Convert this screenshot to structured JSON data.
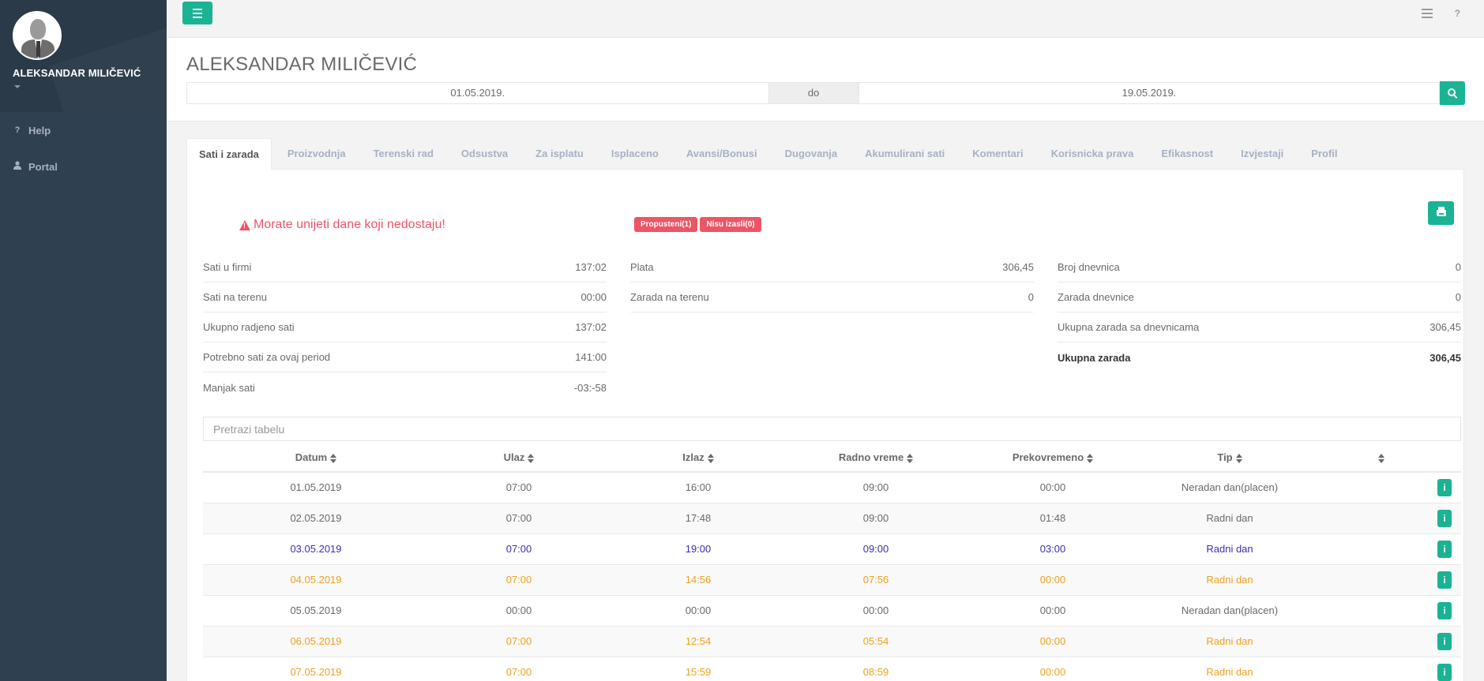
{
  "sidebar": {
    "user_name": "ALEKSANDAR MILIČEVIĆ",
    "items": [
      {
        "label": "Help",
        "icon": "?"
      },
      {
        "label": "Portal",
        "icon": "user-icon"
      }
    ]
  },
  "topbar": {
    "help_label": "?"
  },
  "header": {
    "title": "ALEKSANDAR MILIČEVIĆ",
    "date_from": "01.05.2019.",
    "separator": "do",
    "date_to": "19.05.2019."
  },
  "tabs": [
    {
      "label": "Sati i zarada"
    },
    {
      "label": "Proizvodnja"
    },
    {
      "label": "Terenski rad"
    },
    {
      "label": "Odsustva"
    },
    {
      "label": "Za isplatu"
    },
    {
      "label": "Isplaceno"
    },
    {
      "label": "Avansi/Bonusi"
    },
    {
      "label": "Dugovanja"
    },
    {
      "label": "Akumulirani sati"
    },
    {
      "label": "Komentari"
    },
    {
      "label": "Korisnicka prava"
    },
    {
      "label": "Efikasnost"
    },
    {
      "label": "Izvjestaji"
    },
    {
      "label": "Profil"
    }
  ],
  "alert": {
    "message": "Morate unijeti dane koji nedostaju!",
    "badges": [
      "Propusteni(1)",
      "Nisu izasli(0)"
    ]
  },
  "stats": {
    "col1": [
      {
        "label": "Sati u firmi",
        "value": "137:02"
      },
      {
        "label": "Sati na terenu",
        "value": "00:00"
      },
      {
        "label": "Ukupno radjeno sati",
        "value": "137:02"
      },
      {
        "label": "Potrebno sati za ovaj period",
        "value": "141:00"
      },
      {
        "label": "Manjak sati",
        "value": "-03:-58"
      }
    ],
    "col2": [
      {
        "label": "Plata",
        "value": "306,45"
      },
      {
        "label": "Zarada na terenu",
        "value": "0"
      }
    ],
    "col3": [
      {
        "label": "Broj dnevnica",
        "value": "0"
      },
      {
        "label": "Zarada dnevnice",
        "value": "0"
      },
      {
        "label": "Ukupna zarada sa dnevnicama",
        "value": "306,45"
      },
      {
        "label": "Ukupna zarada",
        "value": "306,45"
      }
    ]
  },
  "table": {
    "search_placeholder": "Pretrazi tabelu",
    "headers": [
      "Datum",
      "Ulaz",
      "Izlaz",
      "Radno vreme",
      "Prekovremeno",
      "Tip",
      ""
    ],
    "rows": [
      {
        "datum": "01.05.2019",
        "ulaz": "07:00",
        "izlaz": "16:00",
        "radno": "09:00",
        "prek": "00:00",
        "tip": "Neradan dan(placen)",
        "color": "#676a6c"
      },
      {
        "datum": "02.05.2019",
        "ulaz": "07:00",
        "izlaz": "17:48",
        "radno": "09:00",
        "prek": "01:48",
        "tip": "Radni dan",
        "color": "#676a6c"
      },
      {
        "datum": "03.05.2019",
        "ulaz": "07:00",
        "izlaz": "19:00",
        "radno": "09:00",
        "prek": "03:00",
        "tip": "Radni dan",
        "color": "#3b2fb5"
      },
      {
        "datum": "04.05.2019",
        "ulaz": "07:00",
        "izlaz": "14:56",
        "radno": "07:56",
        "prek": "00:00",
        "tip": "Radni dan",
        "color": "#f0a020"
      },
      {
        "datum": "05.05.2019",
        "ulaz": "00:00",
        "izlaz": "00:00",
        "radno": "00:00",
        "prek": "00:00",
        "tip": "Neradan dan(placen)",
        "color": "#676a6c"
      },
      {
        "datum": "06.05.2019",
        "ulaz": "07:00",
        "izlaz": "12:54",
        "radno": "05:54",
        "prek": "00:00",
        "tip": "Radni dan",
        "color": "#f0a020"
      },
      {
        "datum": "07.05.2019",
        "ulaz": "07:00",
        "izlaz": "15:59",
        "radno": "08:59",
        "prek": "00:00",
        "tip": "Radni dan",
        "color": "#f0a020"
      }
    ]
  },
  "colors": {
    "accent": "#1ab394",
    "danger": "#ed5565",
    "sidebar": "#2f4050"
  }
}
